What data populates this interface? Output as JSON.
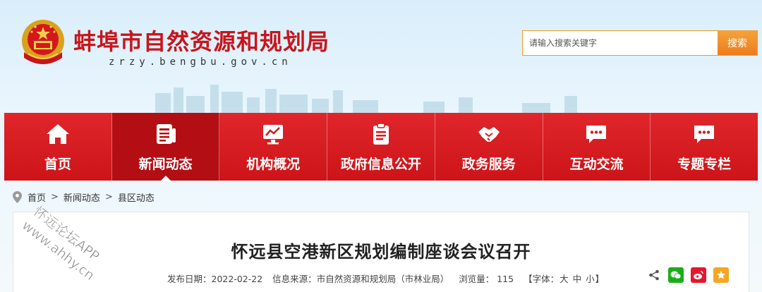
{
  "header": {
    "title": "蚌埠市自然资源和规划局",
    "url": "zrzy.bengbu.gov.cn",
    "search": {
      "placeholder": "请输入搜索关键字",
      "button": "搜索"
    }
  },
  "nav": {
    "items": [
      {
        "label": "首页",
        "icon": "home-icon"
      },
      {
        "label": "新闻动态",
        "icon": "news-icon",
        "active": true
      },
      {
        "label": "机构概况",
        "icon": "monitor-chart-icon"
      },
      {
        "label": "政府信息公开",
        "icon": "clipboard-icon"
      },
      {
        "label": "政务服务",
        "icon": "handshake-icon"
      },
      {
        "label": "互动交流",
        "icon": "chat-bubble-icon"
      },
      {
        "label": "专题专栏",
        "icon": "chat-bubble-icon"
      }
    ]
  },
  "breadcrumb": [
    "首页",
    "新闻动态",
    "县区动态"
  ],
  "article": {
    "title": "怀远县空港新区规划编制座谈会议召开",
    "published_label": "发布日期：",
    "published": "2022-02-22",
    "source_label": "信息来源：",
    "source": "市自然资源和规划局（市林业局）",
    "views_label": "浏览量：",
    "views": "115",
    "font_label": "【字体：",
    "font_large": "大",
    "font_medium": "中",
    "font_small": "小",
    "font_close": "】"
  },
  "share": [
    "share-icon",
    "wechat-icon",
    "weibo-icon",
    "favorite-icon"
  ],
  "watermark": {
    "line1": "怀远论坛APP",
    "line2": "www.ahhy.cn"
  },
  "colors": {
    "primary": "#d8181e",
    "accent": "#ef7f22",
    "wechat": "#1aad19",
    "weibo": "#e6162d",
    "favorite": "#f5a623"
  }
}
